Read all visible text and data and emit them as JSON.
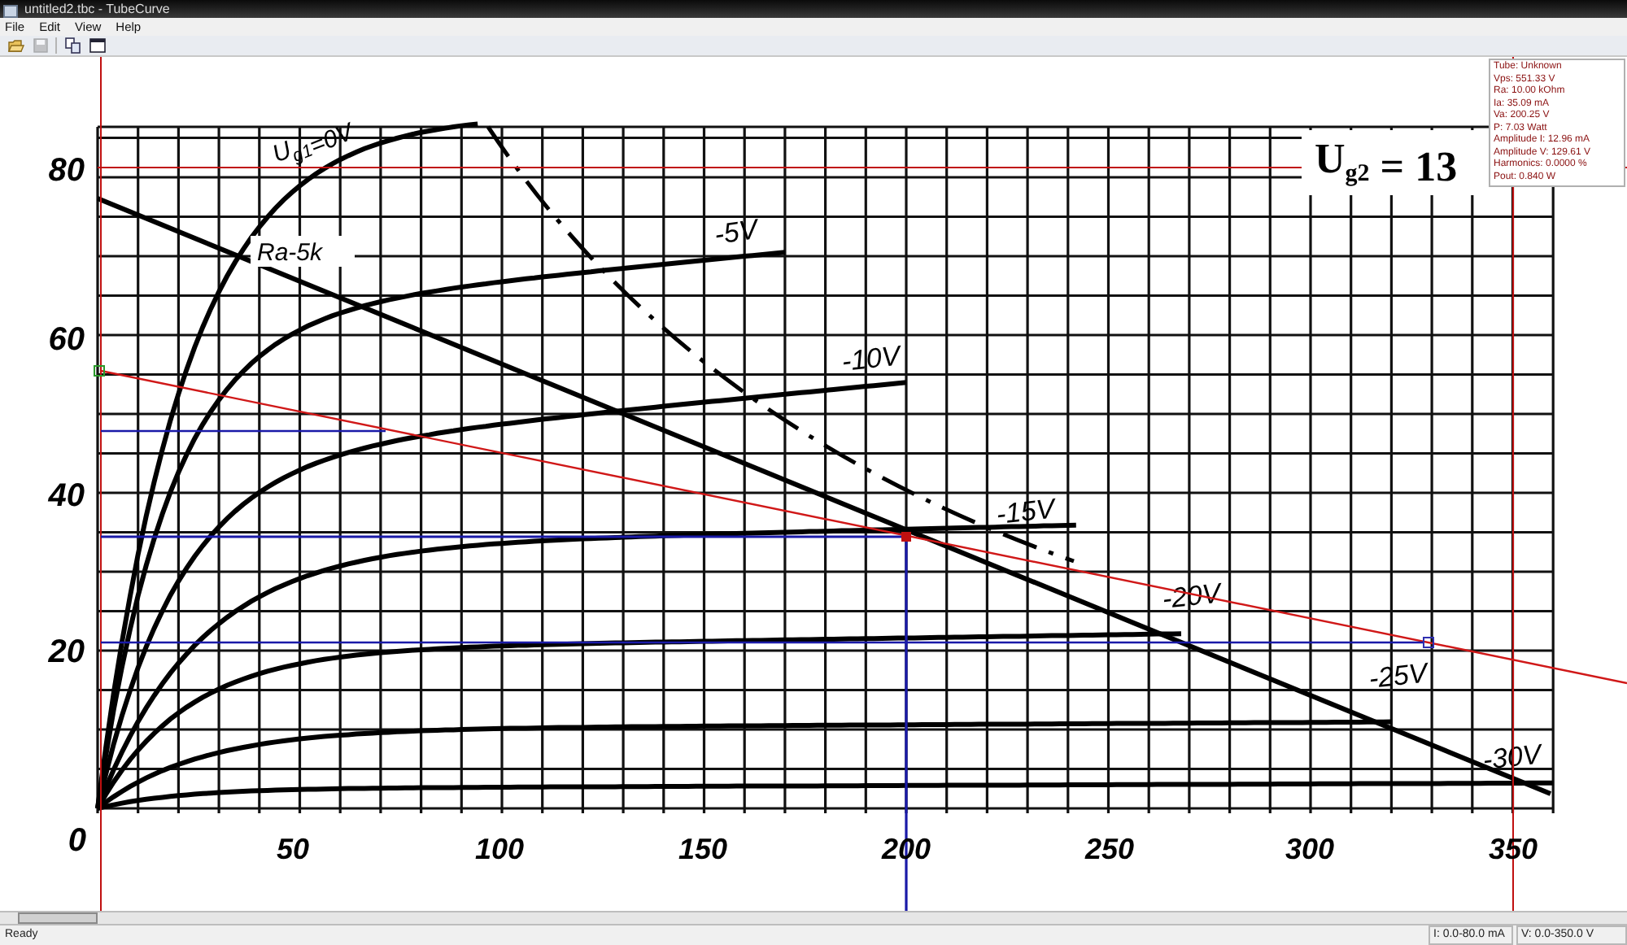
{
  "window": {
    "title": "untitled2.tbc - TubeCurve"
  },
  "menu": [
    "File",
    "Edit",
    "View",
    "Help"
  ],
  "toolbar": [
    {
      "kind": "open",
      "disabled": false
    },
    {
      "kind": "save",
      "disabled": true
    },
    {
      "kind": "copy",
      "disabled": false
    },
    {
      "kind": "window",
      "disabled": false
    }
  ],
  "graph": {
    "y_ticks": [
      "80",
      "60",
      "40",
      "20",
      "0"
    ],
    "x_ticks": [
      "50",
      "100",
      "150",
      "200",
      "250",
      "300",
      "350"
    ],
    "curve_labels": [
      "U$_{g1}$=0V",
      "-5V",
      "-10V",
      "-15V",
      "-20V",
      "-25V",
      "-30V"
    ],
    "load_line_label": "Ra-5k",
    "screen_voltage_label": "U$_{g2}$ = 13"
  },
  "info_panel": [
    "Tube: Unknown",
    "Vps: 551.33 V",
    "Ra: 10.00 kOhm",
    "Ia: 35.09 mA",
    "Va: 200.25 V",
    "P: 7.03 Watt",
    "Amplitude I: 12.96 mA",
    "Amplitude V: 129.61 V",
    "Harmonics: 0.0000 %",
    "Pout: 0.840 W"
  ],
  "status_bar": {
    "message": "Ready",
    "current_range": "I: 0.0-80.0 mA",
    "voltage_range": "V: 0.0-350.0 V"
  }
}
